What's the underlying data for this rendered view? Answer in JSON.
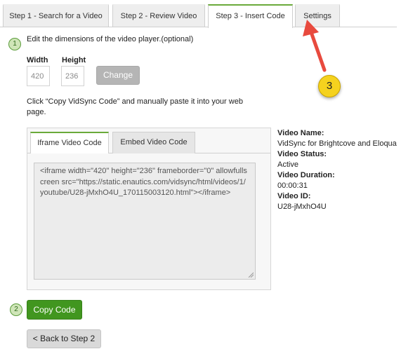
{
  "tabs": [
    {
      "label": "Step 1 - Search for a Video",
      "active": false
    },
    {
      "label": "Step 2 - Review Video",
      "active": false
    },
    {
      "label": "Step 3 - Insert Code",
      "active": true
    },
    {
      "label": "Settings",
      "active": false
    }
  ],
  "step1": {
    "number": "1",
    "instruction": "Edit the dimensions of the video player.(optional)",
    "width_label": "Width",
    "height_label": "Height",
    "width_value": "420",
    "height_value": "236",
    "change_button": "Change"
  },
  "copy_instruction": "Click “Copy VidSync Code” and manually paste it into your web page.",
  "code_tabs": [
    {
      "label": "Iframe Video Code",
      "active": true
    },
    {
      "label": "Embed Video Code",
      "active": false
    }
  ],
  "embed_code": "<iframe width=\"420\" height=\"236\" frameborder=\"0\" allowfullscreen src=\"https://static.enautics.com/vidsync/html/videos/1/youtube/U28-jMxhO4U_170115003120.html\"></iframe>",
  "video_info": {
    "name_label": "Video Name:",
    "name_value": "VidSync for Brightcove and Eloqua",
    "status_label": "Video Status:",
    "status_value": "Active",
    "duration_label": "Video Duration:",
    "duration_value": "00:00:31",
    "id_label": "Video ID:",
    "id_value": "U28-jMxhO4U"
  },
  "step2": {
    "number": "2",
    "copy_button": "Copy Code"
  },
  "back_button": "< Back to Step 2",
  "annotation": {
    "number": "3"
  },
  "colors": {
    "accent_green": "#41961f",
    "tab_active_border": "#6aaa3a",
    "annotation_yellow": "#f5d21e",
    "annotation_arrow": "#e84a3e"
  }
}
